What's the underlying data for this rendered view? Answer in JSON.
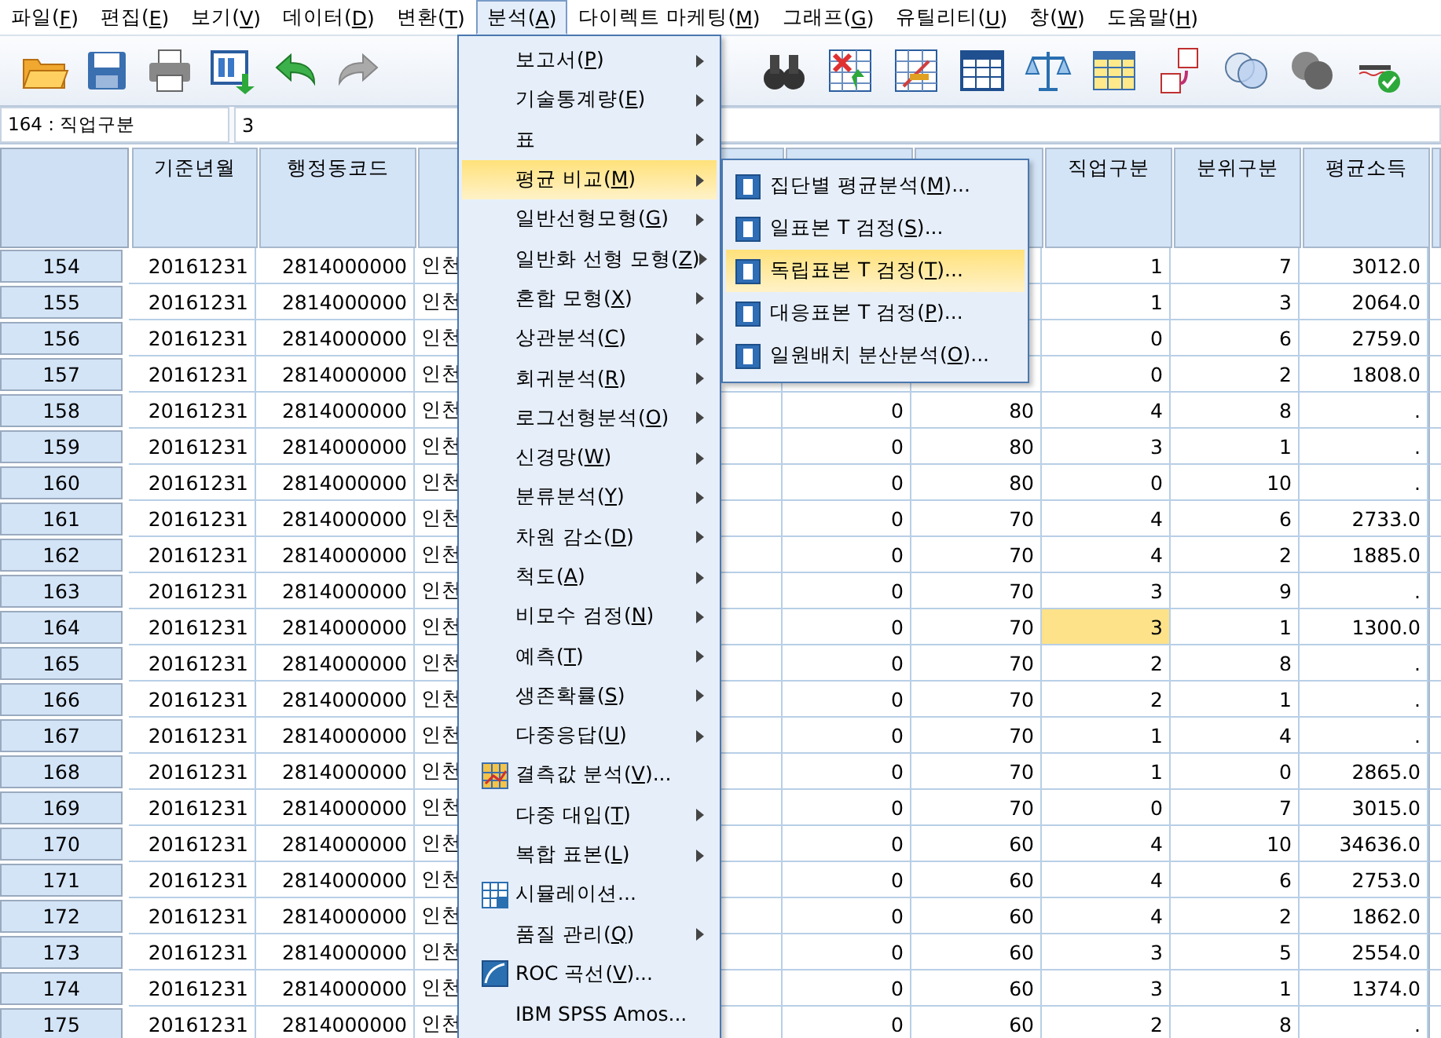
{
  "menubar": [
    {
      "label": "파일(F)",
      "selected": false
    },
    {
      "label": "편집(E)",
      "selected": false
    },
    {
      "label": "보기(V)",
      "selected": false
    },
    {
      "label": "데이터(D)",
      "selected": false
    },
    {
      "label": "변환(T)",
      "selected": false
    },
    {
      "label": "분석(A)",
      "selected": true
    },
    {
      "label": "다이렉트 마케팅(M)",
      "selected": false
    },
    {
      "label": "그래프(G)",
      "selected": false
    },
    {
      "label": "유틸리티(U)",
      "selected": false
    },
    {
      "label": "창(W)",
      "selected": false
    },
    {
      "label": "도움말(H)",
      "selected": false
    }
  ],
  "cell_editor": {
    "reference": "164 : 직업구분",
    "value": "3"
  },
  "grid": {
    "columns": [
      {
        "label": "기준년월",
        "kind": "numeric"
      },
      {
        "label": "행정동코드",
        "kind": "numeric"
      },
      {
        "kind": "string"
      },
      {
        "kind": "numeric"
      },
      {
        "kind": "numeric"
      },
      {
        "label": "직업구분",
        "kind": "numeric"
      },
      {
        "label": "분위구분",
        "kind": "numeric"
      },
      {
        "label": "평균소득",
        "kind": "numeric"
      }
    ],
    "rows": [
      {
        "header": "154",
        "cells": [
          {
            "text": "20161231",
            "selected": false
          },
          {
            "text": "2814000000",
            "selected": false
          },
          {
            "text": "인천",
            "selected": false
          },
          null,
          {
            "selected": false
          },
          {
            "text": "1",
            "selected": false
          },
          {
            "text": "7",
            "selected": false
          },
          {
            "text": "3012.0",
            "selected": false
          }
        ]
      },
      {
        "header": "155",
        "cells": [
          {
            "text": "20161231",
            "selected": false
          },
          {
            "text": "2814000000",
            "selected": false
          },
          {
            "text": "인천",
            "selected": false
          },
          null,
          {
            "selected": false
          },
          {
            "text": "1",
            "selected": false
          },
          {
            "text": "3",
            "selected": false
          },
          {
            "text": "2064.0",
            "selected": false
          }
        ]
      },
      {
        "header": "156",
        "cells": [
          {
            "text": "20161231",
            "selected": false
          },
          {
            "text": "2814000000",
            "selected": false
          },
          {
            "text": "인천",
            "selected": false
          },
          null,
          {
            "selected": false
          },
          {
            "text": "0",
            "selected": false
          },
          {
            "text": "6",
            "selected": false
          },
          {
            "text": "2759.0",
            "selected": false
          }
        ]
      },
      {
        "header": "157",
        "cells": [
          {
            "text": "20161231",
            "selected": false
          },
          {
            "text": "2814000000",
            "selected": false
          },
          {
            "text": "인천",
            "selected": false
          },
          null,
          {
            "selected": false
          },
          {
            "text": "0",
            "selected": false
          },
          {
            "text": "2",
            "selected": false
          },
          {
            "text": "1808.0",
            "selected": false
          }
        ]
      },
      {
        "header": "158",
        "cells": [
          {
            "text": "20161231",
            "selected": false
          },
          {
            "text": "2814000000",
            "selected": false
          },
          {
            "text": "인천",
            "selected": false
          },
          {
            "text": "0",
            "selected": false
          },
          {
            "text": "80",
            "selected": false
          },
          {
            "text": "4",
            "selected": false
          },
          {
            "text": "8",
            "selected": false
          },
          {
            "text": ".",
            "selected": false
          }
        ]
      },
      {
        "header": "159",
        "cells": [
          {
            "text": "20161231",
            "selected": false
          },
          {
            "text": "2814000000",
            "selected": false
          },
          {
            "text": "인천",
            "selected": false
          },
          {
            "text": "0",
            "selected": false
          },
          {
            "text": "80",
            "selected": false
          },
          {
            "text": "3",
            "selected": false
          },
          {
            "text": "1",
            "selected": false
          },
          {
            "text": ".",
            "selected": false
          }
        ]
      },
      {
        "header": "160",
        "cells": [
          {
            "text": "20161231",
            "selected": false
          },
          {
            "text": "2814000000",
            "selected": false
          },
          {
            "text": "인천",
            "selected": false
          },
          {
            "text": "0",
            "selected": false
          },
          {
            "text": "80",
            "selected": false
          },
          {
            "text": "0",
            "selected": false
          },
          {
            "text": "10",
            "selected": false
          },
          {
            "text": ".",
            "selected": false
          }
        ]
      },
      {
        "header": "161",
        "cells": [
          {
            "text": "20161231",
            "selected": false
          },
          {
            "text": "2814000000",
            "selected": false
          },
          {
            "text": "인천",
            "selected": false
          },
          {
            "text": "0",
            "selected": false
          },
          {
            "text": "70",
            "selected": false
          },
          {
            "text": "4",
            "selected": false
          },
          {
            "text": "6",
            "selected": false
          },
          {
            "text": "2733.0",
            "selected": false
          }
        ]
      },
      {
        "header": "162",
        "cells": [
          {
            "text": "20161231",
            "selected": false
          },
          {
            "text": "2814000000",
            "selected": false
          },
          {
            "text": "인천",
            "selected": false
          },
          {
            "text": "0",
            "selected": false
          },
          {
            "text": "70",
            "selected": false
          },
          {
            "text": "4",
            "selected": false
          },
          {
            "text": "2",
            "selected": false
          },
          {
            "text": "1885.0",
            "selected": false
          }
        ]
      },
      {
        "header": "163",
        "cells": [
          {
            "text": "20161231",
            "selected": false
          },
          {
            "text": "2814000000",
            "selected": false
          },
          {
            "text": "인천",
            "selected": false
          },
          {
            "text": "0",
            "selected": false
          },
          {
            "text": "70",
            "selected": false
          },
          {
            "text": "3",
            "selected": false
          },
          {
            "text": "9",
            "selected": false
          },
          {
            "text": ".",
            "selected": false
          }
        ]
      },
      {
        "header": "164",
        "cells": [
          {
            "text": "20161231",
            "selected": false
          },
          {
            "text": "2814000000",
            "selected": false
          },
          {
            "text": "인천",
            "selected": false
          },
          {
            "text": "0",
            "selected": false
          },
          {
            "text": "70",
            "selected": false
          },
          {
            "text": "3",
            "selected": true
          },
          {
            "text": "1",
            "selected": false
          },
          {
            "text": "1300.0",
            "selected": false
          }
        ]
      },
      {
        "header": "165",
        "cells": [
          {
            "text": "20161231",
            "selected": false
          },
          {
            "text": "2814000000",
            "selected": false
          },
          {
            "text": "인천",
            "selected": false
          },
          {
            "text": "0",
            "selected": false
          },
          {
            "text": "70",
            "selected": false
          },
          {
            "text": "2",
            "selected": false
          },
          {
            "text": "8",
            "selected": false
          },
          {
            "text": ".",
            "selected": false
          }
        ]
      },
      {
        "header": "166",
        "cells": [
          {
            "text": "20161231",
            "selected": false
          },
          {
            "text": "2814000000",
            "selected": false
          },
          {
            "text": "인천",
            "selected": false
          },
          {
            "text": "0",
            "selected": false
          },
          {
            "text": "70",
            "selected": false
          },
          {
            "text": "2",
            "selected": false
          },
          {
            "text": "1",
            "selected": false
          },
          {
            "text": ".",
            "selected": false
          }
        ]
      },
      {
        "header": "167",
        "cells": [
          {
            "text": "20161231",
            "selected": false
          },
          {
            "text": "2814000000",
            "selected": false
          },
          {
            "text": "인천",
            "selected": false
          },
          {
            "text": "0",
            "selected": false
          },
          {
            "text": "70",
            "selected": false
          },
          {
            "text": "1",
            "selected": false
          },
          {
            "text": "4",
            "selected": false
          },
          {
            "text": ".",
            "selected": false
          }
        ]
      },
      {
        "header": "168",
        "cells": [
          {
            "text": "20161231",
            "selected": false
          },
          {
            "text": "2814000000",
            "selected": false
          },
          {
            "text": "인천",
            "selected": false
          },
          {
            "text": "0",
            "selected": false
          },
          {
            "text": "70",
            "selected": false
          },
          {
            "text": "1",
            "selected": false
          },
          {
            "text": "0",
            "selected": false
          },
          {
            "text": "2865.0",
            "selected": false
          }
        ]
      },
      {
        "header": "169",
        "cells": [
          {
            "text": "20161231",
            "selected": false
          },
          {
            "text": "2814000000",
            "selected": false
          },
          {
            "text": "인천",
            "selected": false
          },
          {
            "text": "0",
            "selected": false
          },
          {
            "text": "70",
            "selected": false
          },
          {
            "text": "0",
            "selected": false
          },
          {
            "text": "7",
            "selected": false
          },
          {
            "text": "3015.0",
            "selected": false
          }
        ]
      },
      {
        "header": "170",
        "cells": [
          {
            "text": "20161231",
            "selected": false
          },
          {
            "text": "2814000000",
            "selected": false
          },
          {
            "text": "인천",
            "selected": false
          },
          {
            "text": "0",
            "selected": false
          },
          {
            "text": "60",
            "selected": false
          },
          {
            "text": "4",
            "selected": false
          },
          {
            "text": "10",
            "selected": false
          },
          {
            "text": "34636.0",
            "selected": false
          }
        ]
      },
      {
        "header": "171",
        "cells": [
          {
            "text": "20161231",
            "selected": false
          },
          {
            "text": "2814000000",
            "selected": false
          },
          {
            "text": "인천",
            "selected": false
          },
          {
            "text": "0",
            "selected": false
          },
          {
            "text": "60",
            "selected": false
          },
          {
            "text": "4",
            "selected": false
          },
          {
            "text": "6",
            "selected": false
          },
          {
            "text": "2753.0",
            "selected": false
          }
        ]
      },
      {
        "header": "172",
        "cells": [
          {
            "text": "20161231",
            "selected": false
          },
          {
            "text": "2814000000",
            "selected": false
          },
          {
            "text": "인천",
            "selected": false
          },
          {
            "text": "0",
            "selected": false
          },
          {
            "text": "60",
            "selected": false
          },
          {
            "text": "4",
            "selected": false
          },
          {
            "text": "2",
            "selected": false
          },
          {
            "text": "1862.0",
            "selected": false
          }
        ]
      },
      {
        "header": "173",
        "cells": [
          {
            "text": "20161231",
            "selected": false
          },
          {
            "text": "2814000000",
            "selected": false
          },
          {
            "text": "인천",
            "selected": false
          },
          {
            "text": "0",
            "selected": false
          },
          {
            "text": "60",
            "selected": false
          },
          {
            "text": "3",
            "selected": false
          },
          {
            "text": "5",
            "selected": false
          },
          {
            "text": "2554.0",
            "selected": false
          }
        ]
      },
      {
        "header": "174",
        "cells": [
          {
            "text": "20161231",
            "selected": false
          },
          {
            "text": "2814000000",
            "selected": false
          },
          {
            "text": "인천",
            "selected": false
          },
          {
            "text": "0",
            "selected": false
          },
          {
            "text": "60",
            "selected": false
          },
          {
            "text": "3",
            "selected": false
          },
          {
            "text": "1",
            "selected": false
          },
          {
            "text": "1374.0",
            "selected": false
          }
        ]
      },
      {
        "header": "175",
        "cells": [
          {
            "text": "20161231",
            "selected": false
          },
          {
            "text": "2814000000",
            "selected": false
          },
          {
            "text": "인천",
            "selected": false
          },
          {
            "text": "0",
            "selected": false
          },
          {
            "text": "60",
            "selected": false
          },
          {
            "text": "2",
            "selected": false
          },
          {
            "text": "8",
            "selected": false
          },
          {
            "text": ".",
            "selected": false
          }
        ]
      }
    ]
  },
  "analyze_menu": {
    "items": [
      {
        "label": "보고서(P)",
        "kind": "submenu",
        "selected": false
      },
      {
        "label": "기술통계량(E)",
        "kind": "submenu",
        "selected": false
      },
      {
        "label": "표",
        "kind": "submenu",
        "selected": false
      },
      {
        "label": "평균 비교(M)",
        "kind": "submenu",
        "selected": true
      },
      {
        "label": "일반선형모형(G)",
        "kind": "submenu",
        "selected": false
      },
      {
        "label": "일반화 선형 모형(Z)",
        "kind": "submenu",
        "selected": false
      },
      {
        "label": "혼합 모형(X)",
        "kind": "submenu",
        "selected": false
      },
      {
        "label": "상관분석(C)",
        "kind": "submenu",
        "selected": false
      },
      {
        "label": "회귀분석(R)",
        "kind": "submenu",
        "selected": false
      },
      {
        "label": "로그선형분석(O)",
        "kind": "submenu",
        "selected": false
      },
      {
        "label": "신경망(W)",
        "kind": "submenu",
        "selected": false
      },
      {
        "label": "분류분석(Y)",
        "kind": "submenu",
        "selected": false
      },
      {
        "label": "차원 감소(D)",
        "kind": "submenu",
        "selected": false
      },
      {
        "label": "척도(A)",
        "kind": "submenu",
        "selected": false
      },
      {
        "label": "비모수 검정(N)",
        "kind": "submenu",
        "selected": false
      },
      {
        "label": "예측(T)",
        "kind": "submenu",
        "selected": false
      },
      {
        "label": "생존확률(S)",
        "kind": "submenu",
        "selected": false
      },
      {
        "label": "다중응답(U)",
        "kind": "submenu",
        "selected": false
      },
      {
        "label": "결측값 분석(V)...",
        "kind": "icon-command",
        "selected": false
      },
      {
        "label": "다중 대입(T)",
        "kind": "submenu",
        "selected": false
      },
      {
        "label": "복합 표본(L)",
        "kind": "submenu",
        "selected": false
      },
      {
        "label": "시뮬레이션...",
        "kind": "icon-command",
        "selected": false
      },
      {
        "label": "품질 관리(Q)",
        "kind": "submenu",
        "selected": false
      },
      {
        "label": "ROC 곡선(V)...",
        "kind": "icon-command",
        "selected": false
      },
      {
        "label": "IBM SPSS Amos...",
        "kind": "command",
        "selected": false
      }
    ]
  },
  "compare_means_menu": {
    "items": [
      {
        "label": "집단별 평균분석(M)...",
        "selected": false
      },
      {
        "label": "일표본 T 검정(S)...",
        "selected": false
      },
      {
        "label": "독립표본 T 검정(T)...",
        "selected": true
      },
      {
        "label": "대응표본 T 검정(P)...",
        "selected": false
      },
      {
        "label": "일원배치 분산분석(O)...",
        "selected": false
      }
    ]
  }
}
